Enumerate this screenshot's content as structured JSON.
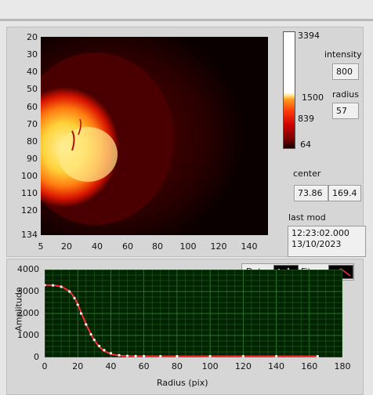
{
  "image_axes": {
    "y_ticks": [
      "20",
      "30",
      "40",
      "50",
      "60",
      "70",
      "80",
      "90",
      "100",
      "110",
      "120",
      "134"
    ],
    "x_ticks": [
      "5",
      "20",
      "40",
      "60",
      "80",
      "100",
      "120",
      "140"
    ]
  },
  "colorscale": {
    "labels": [
      "3394",
      "1500",
      "839",
      "64"
    ]
  },
  "controls": {
    "intensity_label": "intensity",
    "intensity_value": "800",
    "radius_label": "radius",
    "radius_value": "57",
    "center_label": "center",
    "center_x": "73.86",
    "center_y": "169.4",
    "lastmod_label": "last mod",
    "lastmod_time": "12:23:02.000",
    "lastmod_date": "13/10/2023"
  },
  "legend": {
    "data_label": "Data",
    "fit_label": "Fit"
  },
  "chart_data": {
    "type": "line",
    "xlabel": "Radius (pix)",
    "ylabel": "Amplitude",
    "xlim": [
      0,
      180
    ],
    "ylim": [
      0,
      4000
    ],
    "x_ticks": [
      "0",
      "20",
      "40",
      "60",
      "80",
      "100",
      "120",
      "140",
      "160",
      "180"
    ],
    "y_ticks": [
      "0",
      "1000",
      "2000",
      "3000",
      "4000"
    ],
    "grid": true,
    "series": [
      {
        "name": "Data",
        "x": [
          0,
          5,
          10,
          15,
          18,
          20,
          22,
          25,
          28,
          30,
          33,
          36,
          40,
          45,
          50,
          55,
          60,
          70,
          80,
          100,
          120,
          140,
          165
        ],
        "values": [
          3290,
          3280,
          3220,
          3000,
          2700,
          2400,
          2000,
          1500,
          1050,
          800,
          520,
          330,
          190,
          100,
          70,
          60,
          55,
          50,
          50,
          48,
          48,
          48,
          48
        ]
      },
      {
        "name": "Fit",
        "x": [
          0,
          5,
          10,
          15,
          18,
          20,
          22,
          25,
          28,
          30,
          33,
          36,
          40,
          45,
          50,
          55,
          60,
          70,
          80,
          100,
          120,
          140,
          165
        ],
        "values": [
          3300,
          3290,
          3230,
          3020,
          2720,
          2420,
          2050,
          1520,
          1050,
          780,
          480,
          290,
          150,
          80,
          60,
          55,
          52,
          50,
          50,
          48,
          48,
          48,
          48
        ]
      }
    ]
  }
}
